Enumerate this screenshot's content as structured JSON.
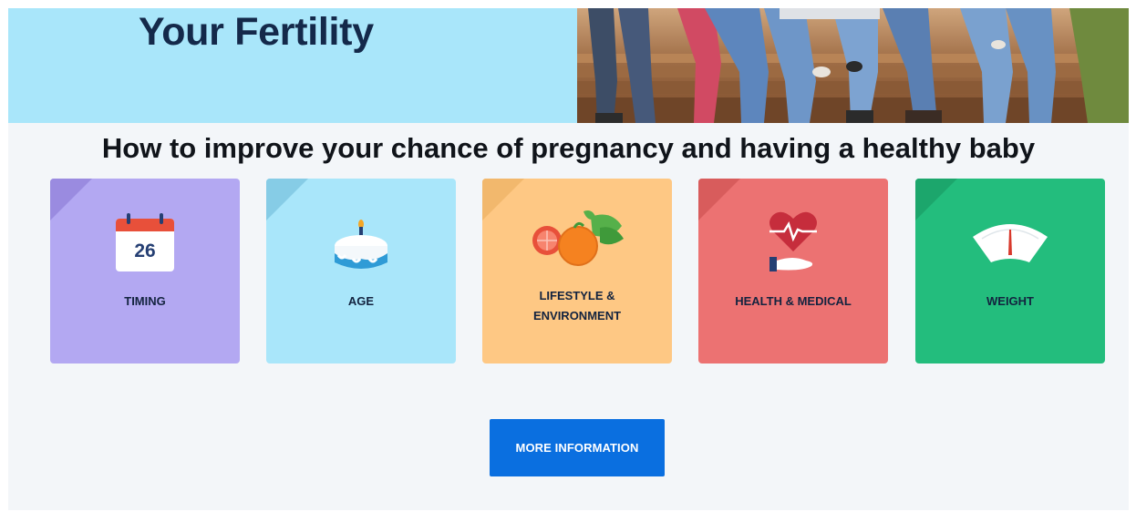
{
  "hero": {
    "title": "Your Fertility"
  },
  "headline": "How to improve your chance of pregnancy and having a healthy baby",
  "cards": [
    {
      "label": "TIMING",
      "icon": "calendar-icon",
      "icon_text": "26",
      "color": "#b3a8f2"
    },
    {
      "label": "AGE",
      "icon": "birthday-cake-icon",
      "color": "#a9e6fa"
    },
    {
      "label_lines": [
        "LIFESTYLE &",
        "ENVIRONMENT"
      ],
      "icon": "fruit-icon",
      "color": "#fec884"
    },
    {
      "label": "HEALTH & MEDICAL",
      "icon": "heart-in-hand-icon",
      "color": "#ec7272"
    },
    {
      "label": "WEIGHT",
      "icon": "scale-icon",
      "color": "#23bd7d"
    }
  ],
  "cta": {
    "label": "MORE INFORMATION",
    "color": "#0a6fe0"
  }
}
